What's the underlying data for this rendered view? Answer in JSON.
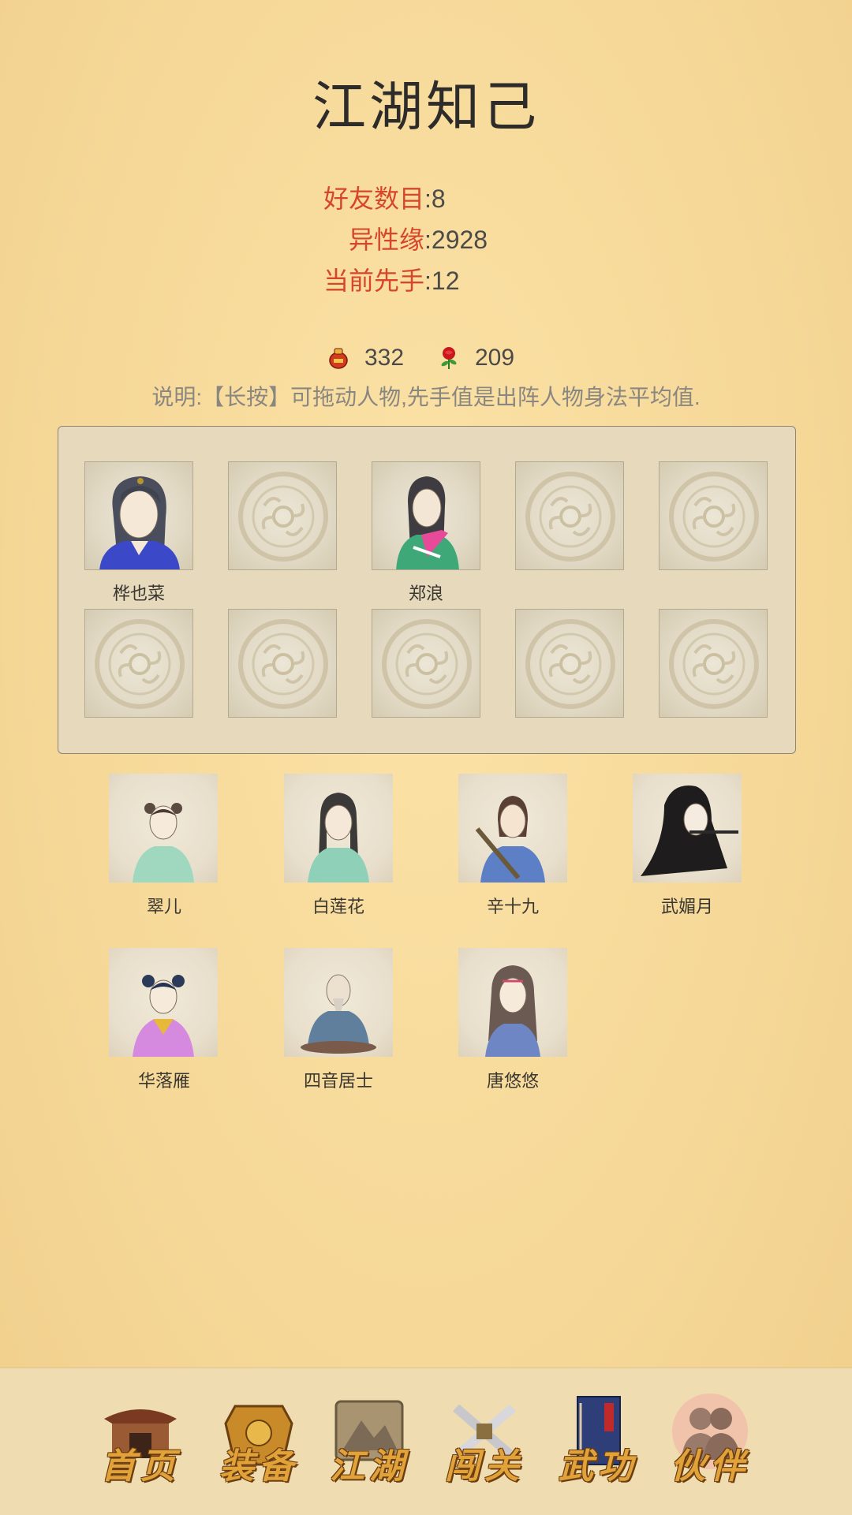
{
  "page": {
    "title": "江湖知己"
  },
  "stats": [
    {
      "label": "好友数目",
      "value": "8"
    },
    {
      "label": "异性缘",
      "value": "2928"
    },
    {
      "label": "当前先手",
      "value": "12"
    }
  ],
  "resources": [
    {
      "icon": "red-gourd-icon",
      "value": "332"
    },
    {
      "icon": "red-rose-icon",
      "value": "209"
    }
  ],
  "note": "说明:【长按】可拖动人物,先手值是出阵人物身法平均值.",
  "team": {
    "slots": [
      {
        "name": "桦也菜",
        "filled": true
      },
      {
        "name": "",
        "filled": false
      },
      {
        "name": "郑浪",
        "filled": true
      },
      {
        "name": "",
        "filled": false
      },
      {
        "name": "",
        "filled": false
      },
      {
        "name": "",
        "filled": false
      },
      {
        "name": "",
        "filled": false
      },
      {
        "name": "",
        "filled": false
      },
      {
        "name": "",
        "filled": false
      },
      {
        "name": "",
        "filled": false
      }
    ]
  },
  "companions": [
    {
      "name": "翠儿"
    },
    {
      "name": "白莲花"
    },
    {
      "name": "辛十九"
    },
    {
      "name": "武媚月"
    },
    {
      "name": "华落雁"
    },
    {
      "name": "四音居士"
    },
    {
      "name": "唐悠悠"
    }
  ],
  "nav": [
    {
      "label": "首页",
      "icon": "temple-icon"
    },
    {
      "label": "装备",
      "icon": "armor-icon"
    },
    {
      "label": "江湖",
      "icon": "scroll-map-icon"
    },
    {
      "label": "闯关",
      "icon": "crossed-swords-icon"
    },
    {
      "label": "武功",
      "icon": "martial-book-icon"
    },
    {
      "label": "伙伴",
      "icon": "partners-icon",
      "active": true
    }
  ]
}
